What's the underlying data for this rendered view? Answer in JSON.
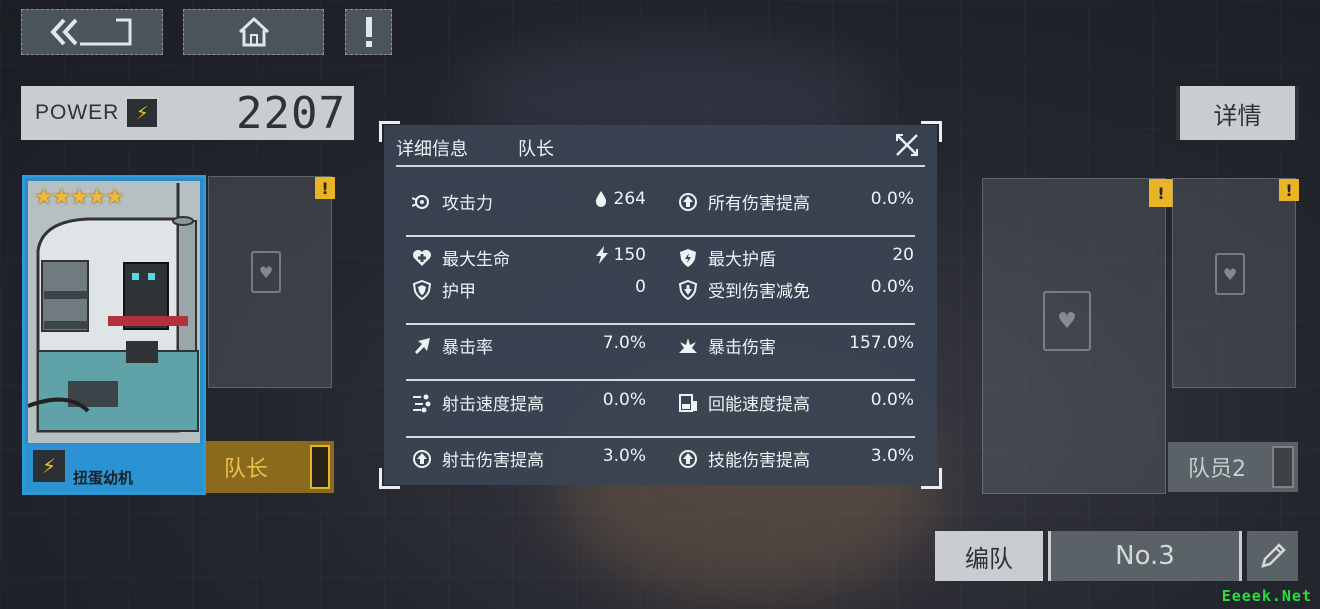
{
  "top_buttons": {
    "back_icon": "back-arrow-icon",
    "home_icon": "home-icon",
    "alert_icon": "exclamation-icon"
  },
  "power": {
    "label": "POWER",
    "value": "2207"
  },
  "character": {
    "stars": "★★★★★",
    "name": "扭蛋幼机",
    "role_tag": "队长"
  },
  "warn_mark": "!",
  "right_panel": {
    "detail_button": "详情",
    "member_slot_label": "队员2"
  },
  "team_bar": {
    "label": "编队",
    "number": "No.3"
  },
  "watermark": "Eeeek.Net",
  "modal": {
    "title": "详细信息",
    "tab": "队长",
    "rows": [
      {
        "left_label": "攻击力",
        "left_value_icon": "drop-icon",
        "left_value": "264",
        "right_label": "所有伤害提高",
        "right_value": "0.0%"
      },
      {
        "left_label": "最大生命",
        "left_value_icon": "bolt-icon",
        "left_value": "150",
        "right_label": "最大护盾",
        "right_value": "20"
      },
      {
        "left_label": "护甲",
        "left_value": "0",
        "right_label": "受到伤害减免",
        "right_value": "0.0%"
      },
      {
        "left_label": "暴击率",
        "left_value": "7.0%",
        "right_label": "暴击伤害",
        "right_value": "157.0%"
      },
      {
        "left_label": "射击速度提高",
        "left_value": "0.0%",
        "right_label": "回能速度提高",
        "right_value": "0.0%"
      },
      {
        "left_label": "射击伤害提高",
        "left_value": "3.0%",
        "right_label": "技能伤害提高",
        "right_value": "3.0%"
      }
    ]
  },
  "colors": {
    "accent_blue": "#2b93d1",
    "leader_gold": "#e3b433",
    "warn_yellow": "#e9b527"
  }
}
